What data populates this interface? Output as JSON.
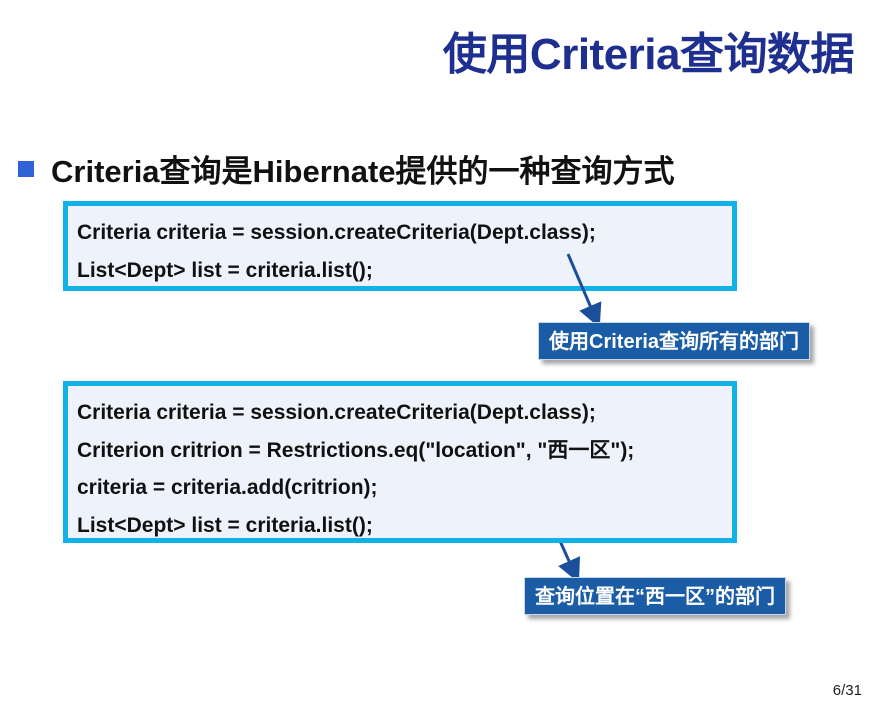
{
  "slide": {
    "title": "使用Criteria查询数据",
    "bullet": "Criteria查询是Hibernate提供的一种查询方式",
    "page_number": "6/31"
  },
  "code_block_1": {
    "lines": [
      "Criteria criteria = session.createCriteria(Dept.class);",
      "List<Dept> list = criteria.list();"
    ]
  },
  "callout_1": "使用Criteria查询所有的部门",
  "code_block_2": {
    "lines": [
      "Criteria criteria = session.createCriteria(Dept.class);",
      "Criterion critrion = Restrictions.eq(\"location\", \"西一区\");",
      "criteria = criteria.add(critrion);",
      "List<Dept> list = criteria.list();"
    ]
  },
  "callout_2": "查询位置在“西一区”的部门",
  "colors": {
    "title": "#1f2f8f",
    "bullet": "#2f63d6",
    "code_border": "#10b2e8",
    "code_bg": "#eef3fb",
    "callout_bg": "#1b5ca7",
    "arrow": "#1b4f9b"
  }
}
